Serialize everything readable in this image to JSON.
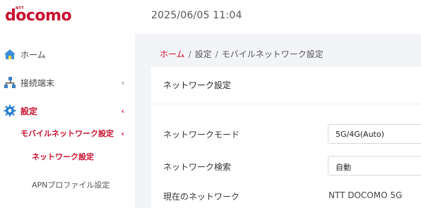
{
  "brand": {
    "logo": "docomo",
    "ntt": "NTT"
  },
  "header": {
    "datetime": "2025/06/05 11:04"
  },
  "sidebar": {
    "items": [
      {
        "label": "ホーム",
        "icon": "home-icon"
      },
      {
        "label": "接続端末",
        "icon": "network-devices-icon",
        "chevron": "‹"
      },
      {
        "label": "設定",
        "icon": "gear-icon",
        "chevron": "‹"
      }
    ],
    "sub_items": [
      {
        "label": "モバイルネットワーク設定",
        "chevron": "‹"
      },
      {
        "label": "ネットワーク設定"
      },
      {
        "label": "APNプロファイル設定"
      }
    ]
  },
  "breadcrumb": {
    "home": "ホーム",
    "sep": "/",
    "level1": "設定",
    "level2": "モバイルネットワーク設定"
  },
  "card": {
    "title": "ネットワーク設定",
    "rows": [
      {
        "label": "ネットワークモード",
        "value": "5G/4G(Auto)"
      },
      {
        "label": "ネットワーク検索",
        "value": "自動"
      },
      {
        "label": "現在のネットワーク",
        "value": "NTT DOCOMO 5G"
      }
    ]
  },
  "colors": {
    "accent": "#c8102e",
    "home_icon": "#3a8fd6",
    "gear_icon": "#2b7fd0"
  }
}
